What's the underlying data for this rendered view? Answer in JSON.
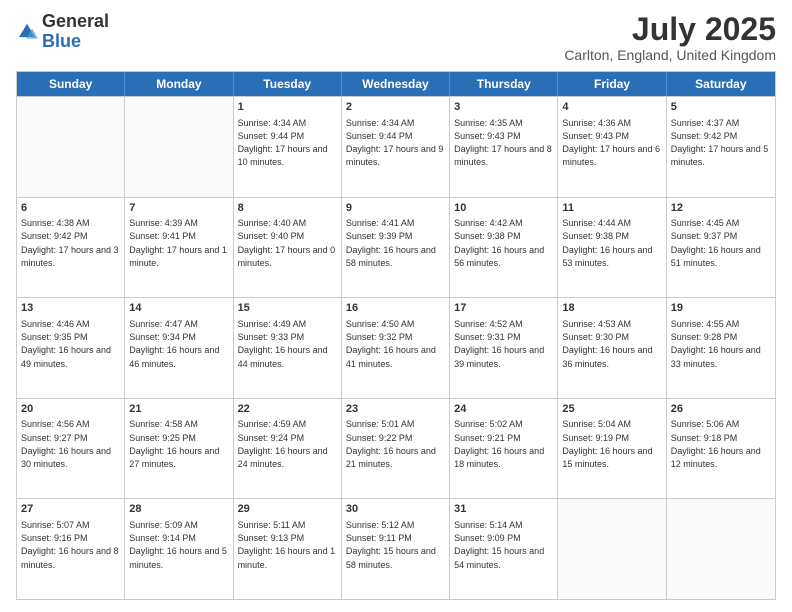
{
  "header": {
    "logo_general": "General",
    "logo_blue": "Blue",
    "month_title": "July 2025",
    "location": "Carlton, England, United Kingdom"
  },
  "days_of_week": [
    "Sunday",
    "Monday",
    "Tuesday",
    "Wednesday",
    "Thursday",
    "Friday",
    "Saturday"
  ],
  "rows": [
    [
      {
        "day": "",
        "info": "",
        "empty": true
      },
      {
        "day": "",
        "info": "",
        "empty": true
      },
      {
        "day": "1",
        "info": "Sunrise: 4:34 AM\nSunset: 9:44 PM\nDaylight: 17 hours and 10 minutes."
      },
      {
        "day": "2",
        "info": "Sunrise: 4:34 AM\nSunset: 9:44 PM\nDaylight: 17 hours and 9 minutes."
      },
      {
        "day": "3",
        "info": "Sunrise: 4:35 AM\nSunset: 9:43 PM\nDaylight: 17 hours and 8 minutes."
      },
      {
        "day": "4",
        "info": "Sunrise: 4:36 AM\nSunset: 9:43 PM\nDaylight: 17 hours and 6 minutes."
      },
      {
        "day": "5",
        "info": "Sunrise: 4:37 AM\nSunset: 9:42 PM\nDaylight: 17 hours and 5 minutes."
      }
    ],
    [
      {
        "day": "6",
        "info": "Sunrise: 4:38 AM\nSunset: 9:42 PM\nDaylight: 17 hours and 3 minutes."
      },
      {
        "day": "7",
        "info": "Sunrise: 4:39 AM\nSunset: 9:41 PM\nDaylight: 17 hours and 1 minute."
      },
      {
        "day": "8",
        "info": "Sunrise: 4:40 AM\nSunset: 9:40 PM\nDaylight: 17 hours and 0 minutes."
      },
      {
        "day": "9",
        "info": "Sunrise: 4:41 AM\nSunset: 9:39 PM\nDaylight: 16 hours and 58 minutes."
      },
      {
        "day": "10",
        "info": "Sunrise: 4:42 AM\nSunset: 9:38 PM\nDaylight: 16 hours and 56 minutes."
      },
      {
        "day": "11",
        "info": "Sunrise: 4:44 AM\nSunset: 9:38 PM\nDaylight: 16 hours and 53 minutes."
      },
      {
        "day": "12",
        "info": "Sunrise: 4:45 AM\nSunset: 9:37 PM\nDaylight: 16 hours and 51 minutes."
      }
    ],
    [
      {
        "day": "13",
        "info": "Sunrise: 4:46 AM\nSunset: 9:35 PM\nDaylight: 16 hours and 49 minutes."
      },
      {
        "day": "14",
        "info": "Sunrise: 4:47 AM\nSunset: 9:34 PM\nDaylight: 16 hours and 46 minutes."
      },
      {
        "day": "15",
        "info": "Sunrise: 4:49 AM\nSunset: 9:33 PM\nDaylight: 16 hours and 44 minutes."
      },
      {
        "day": "16",
        "info": "Sunrise: 4:50 AM\nSunset: 9:32 PM\nDaylight: 16 hours and 41 minutes."
      },
      {
        "day": "17",
        "info": "Sunrise: 4:52 AM\nSunset: 9:31 PM\nDaylight: 16 hours and 39 minutes."
      },
      {
        "day": "18",
        "info": "Sunrise: 4:53 AM\nSunset: 9:30 PM\nDaylight: 16 hours and 36 minutes."
      },
      {
        "day": "19",
        "info": "Sunrise: 4:55 AM\nSunset: 9:28 PM\nDaylight: 16 hours and 33 minutes."
      }
    ],
    [
      {
        "day": "20",
        "info": "Sunrise: 4:56 AM\nSunset: 9:27 PM\nDaylight: 16 hours and 30 minutes."
      },
      {
        "day": "21",
        "info": "Sunrise: 4:58 AM\nSunset: 9:25 PM\nDaylight: 16 hours and 27 minutes."
      },
      {
        "day": "22",
        "info": "Sunrise: 4:59 AM\nSunset: 9:24 PM\nDaylight: 16 hours and 24 minutes."
      },
      {
        "day": "23",
        "info": "Sunrise: 5:01 AM\nSunset: 9:22 PM\nDaylight: 16 hours and 21 minutes."
      },
      {
        "day": "24",
        "info": "Sunrise: 5:02 AM\nSunset: 9:21 PM\nDaylight: 16 hours and 18 minutes."
      },
      {
        "day": "25",
        "info": "Sunrise: 5:04 AM\nSunset: 9:19 PM\nDaylight: 16 hours and 15 minutes."
      },
      {
        "day": "26",
        "info": "Sunrise: 5:06 AM\nSunset: 9:18 PM\nDaylight: 16 hours and 12 minutes."
      }
    ],
    [
      {
        "day": "27",
        "info": "Sunrise: 5:07 AM\nSunset: 9:16 PM\nDaylight: 16 hours and 8 minutes."
      },
      {
        "day": "28",
        "info": "Sunrise: 5:09 AM\nSunset: 9:14 PM\nDaylight: 16 hours and 5 minutes."
      },
      {
        "day": "29",
        "info": "Sunrise: 5:11 AM\nSunset: 9:13 PM\nDaylight: 16 hours and 1 minute."
      },
      {
        "day": "30",
        "info": "Sunrise: 5:12 AM\nSunset: 9:11 PM\nDaylight: 15 hours and 58 minutes."
      },
      {
        "day": "31",
        "info": "Sunrise: 5:14 AM\nSunset: 9:09 PM\nDaylight: 15 hours and 54 minutes."
      },
      {
        "day": "",
        "info": "",
        "empty": true
      },
      {
        "day": "",
        "info": "",
        "empty": true
      }
    ]
  ]
}
